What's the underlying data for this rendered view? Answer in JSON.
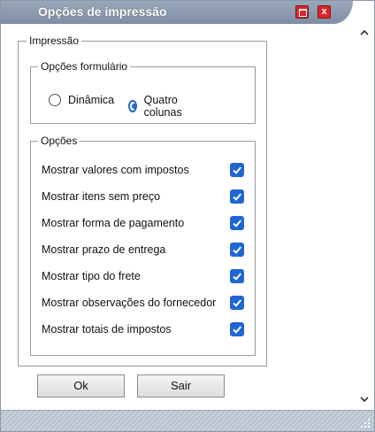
{
  "window": {
    "title": "Opções de impressão",
    "maximize_icon": "maximize-icon",
    "close_icon": "close-icon",
    "close_symbol": "x",
    "accent_color": "#1f66d4",
    "close_color": "#d9262b"
  },
  "groups": {
    "main_legend": "Impressão",
    "form_legend": "Opções formulário",
    "options_legend": "Opções"
  },
  "form_options": {
    "radios": [
      {
        "label": "Dinâmica",
        "checked": false
      },
      {
        "label": "Quatro colunas",
        "checked": true
      }
    ]
  },
  "options": [
    {
      "label": "Mostrar valores com impostos",
      "checked": true
    },
    {
      "label": "Mostrar itens sem preço",
      "checked": true
    },
    {
      "label": "Mostrar forma de pagamento",
      "checked": true
    },
    {
      "label": "Mostrar prazo de entrega",
      "checked": true
    },
    {
      "label": "Mostrar tipo do frete",
      "checked": true
    },
    {
      "label": "Mostrar observações do fornecedor",
      "checked": true
    },
    {
      "label": "Mostrar totais de impostos",
      "checked": true
    }
  ],
  "buttons": {
    "ok_label": "Ok",
    "sair_label": "Sair"
  },
  "scrollbar": {
    "up_icon": "chevron-up-icon",
    "down_icon": "chevron-down-icon"
  }
}
